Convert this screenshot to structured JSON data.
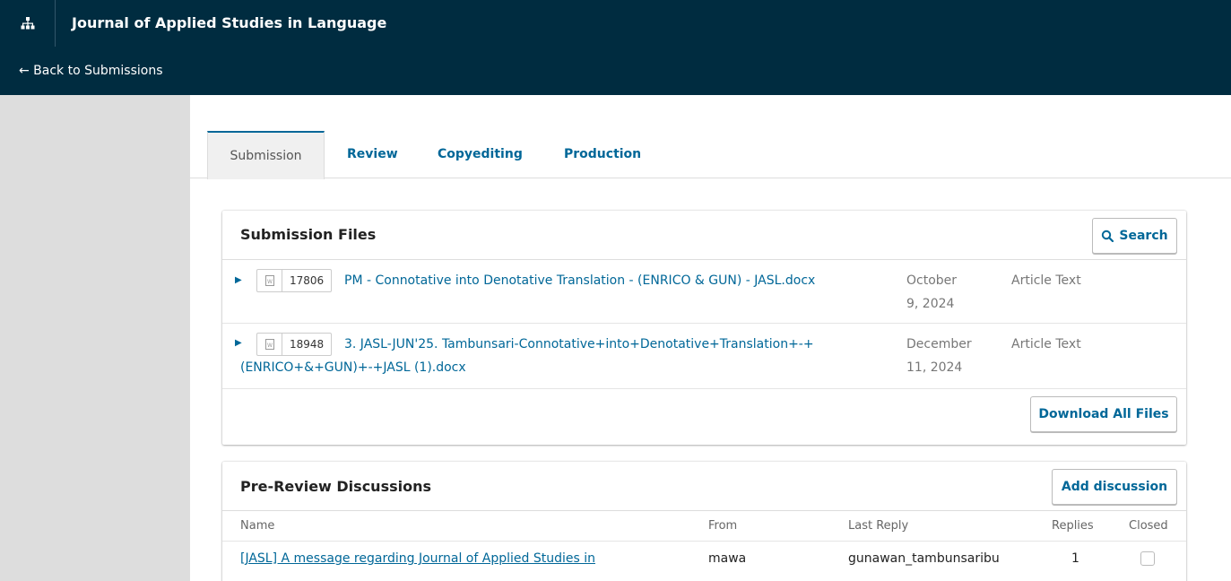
{
  "header": {
    "journal_title": "Journal of Applied Studies in Language",
    "back_link": "← Back to Submissions"
  },
  "tabs": [
    {
      "label": "Submission",
      "active": true
    },
    {
      "label": "Review",
      "active": false
    },
    {
      "label": "Copyediting",
      "active": false
    },
    {
      "label": "Production",
      "active": false
    }
  ],
  "submission_files": {
    "title": "Submission Files",
    "search_label": "Search",
    "download_all_label": "Download All Files",
    "files": [
      {
        "id": "17806",
        "name": "PM - Connotative into Denotative Translation - (ENRICO & GUN) - JASL.docx",
        "date_line1": "October",
        "date_line2": "9, 2024",
        "type": "Article Text"
      },
      {
        "id": "18948",
        "name_line1": "3. JASL-JUN'25. Tambunsari-Connotative+into+Denotative+Translation+-+",
        "name_line2": "(ENRICO+&+GUN)+-+JASL (1).docx",
        "date_line1": "December",
        "date_line2": "11, 2024",
        "type": "Article Text"
      }
    ]
  },
  "discussions": {
    "title": "Pre-Review Discussions",
    "add_label": "Add discussion",
    "columns": {
      "name": "Name",
      "from": "From",
      "last_reply": "Last Reply",
      "replies": "Replies",
      "closed": "Closed"
    },
    "rows": [
      {
        "name": "[JASL] A message regarding Journal of Applied Studies in",
        "from": "mawa",
        "last_reply": "gunawan_tambunsaribu",
        "replies": "1",
        "closed": false
      }
    ]
  },
  "colors": {
    "nav_bg": "#002c40",
    "link": "#006798"
  },
  "icons": {
    "sitemap": "sitemap-icon",
    "search": "search-icon",
    "file": "word-file-icon",
    "expand": "caret-right-icon"
  }
}
